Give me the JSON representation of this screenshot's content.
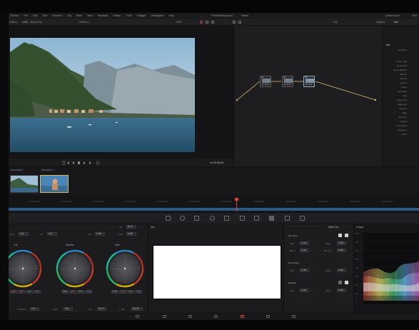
{
  "menu": [
    "DaVinci",
    "File",
    "Edit",
    "Trim",
    "Timeline",
    "Clip",
    "Mark",
    "View",
    "Playback",
    "Fusion",
    "Color",
    "Fairlight",
    "Workspace",
    "Help"
  ],
  "project": {
    "title": "FilmAvidDaylooks 2",
    "edited": "Edited"
  },
  "top_right": {
    "quick_export": "Quick Export",
    "full": "Full"
  },
  "toolbar": {
    "left_label": "Gallery",
    "lut_label": "LUTs",
    "media_label": "Media Pool",
    "timeline_name": "Timeline 1",
    "zoom": "100%",
    "mode": "Clip",
    "lightbox": "Lightbox",
    "info": "Info"
  },
  "viewer": {
    "timecode": "01:00:48:25",
    "transport_time": "00:00:00:00"
  },
  "nodes": [
    {
      "num": "01"
    },
    {
      "num": "02"
    },
    {
      "num": "03"
    }
  ],
  "inspector": {
    "title": "Info",
    "rows": [
      "Clip Name",
      "Source Start",
      "Source End",
      "Source Duration",
      "Start TC",
      "End TC",
      "Frames",
      "Codec",
      "Resolution",
      "Date",
      "Frame Rate",
      "Data Level",
      "Audio Ch",
      "Flags",
      "Clip Color",
      "Gamma",
      "Color Space",
      "Sharpness",
      "Noise"
    ]
  },
  "clips": [
    {
      "label": "A001C008_1"
    },
    {
      "label": "A001C012_2"
    }
  ],
  "ruler": [
    "01:00:00:00",
    "01:00:04:00",
    "01:00:08:00",
    "01:00:12:00",
    "01:00:16:00",
    "01:00:20:00",
    "01:00:24:00",
    "01:00:28:00",
    "01:00:32:00",
    "01:00:36:00",
    "01:00:40:00",
    "01:00:44:00"
  ],
  "color_panel": {
    "header": [
      {
        "label": "Temp",
        "value": "0.00"
      },
      {
        "label": "Tint",
        "value": "0.00"
      },
      {
        "label": "Cont",
        "value": "1.000"
      },
      {
        "label": "Pivot",
        "value": "0.435"
      },
      {
        "label": "Sat",
        "value": "50.00"
      }
    ],
    "wheels": [
      {
        "name": "Lift",
        "r": "0.00",
        "g": "0.00",
        "b": "0.00",
        "y": "0.00"
      },
      {
        "name": "Gamma",
        "r": "0.00",
        "g": "0.00",
        "b": "0.00",
        "y": "0.00"
      },
      {
        "name": "Gain",
        "r": "1.00",
        "g": "1.00",
        "b": "1.00",
        "y": "1.00"
      }
    ],
    "footer": [
      {
        "label": "Col Boost",
        "value": "0.00"
      },
      {
        "label": "Shad",
        "value": "0.00"
      },
      {
        "label": "Hi/Light",
        "value": "0.00"
      },
      {
        "label": "Sat",
        "value": "50.00"
      },
      {
        "label": "Hue",
        "value": "50.00"
      },
      {
        "label": "L. Mix",
        "value": "100.00"
      }
    ]
  },
  "keyer": {
    "title": "Key"
  },
  "qualifier": {
    "title": "Matte Key",
    "sections": [
      {
        "name": "Key Input",
        "fields": [
          {
            "label": "Gain",
            "value": "1.000"
          },
          {
            "label": "Offset",
            "value": "0.000"
          },
          {
            "label": "Blur R.",
            "value": "0.000"
          },
          {
            "label": "Blur H/V",
            "value": "0.000"
          }
        ]
      },
      {
        "name": "Key Output",
        "fields": [
          {
            "label": "Gain",
            "value": "1.000"
          },
          {
            "label": "Offset",
            "value": "0.000"
          }
        ]
      },
      {
        "name": "Qualifier",
        "fields": [
          {
            "label": "Gain",
            "value": "1.000"
          },
          {
            "label": "Offset",
            "value": "0.000"
          }
        ]
      }
    ]
  },
  "scopes": {
    "title": "Scopes",
    "scale": [
      "1023",
      "896",
      "768",
      "640",
      "512",
      "384",
      "256",
      "128",
      "0"
    ]
  },
  "colors": {
    "accent": "#e24242",
    "track": "#2c5a84",
    "panel": "#1c1c1f"
  }
}
